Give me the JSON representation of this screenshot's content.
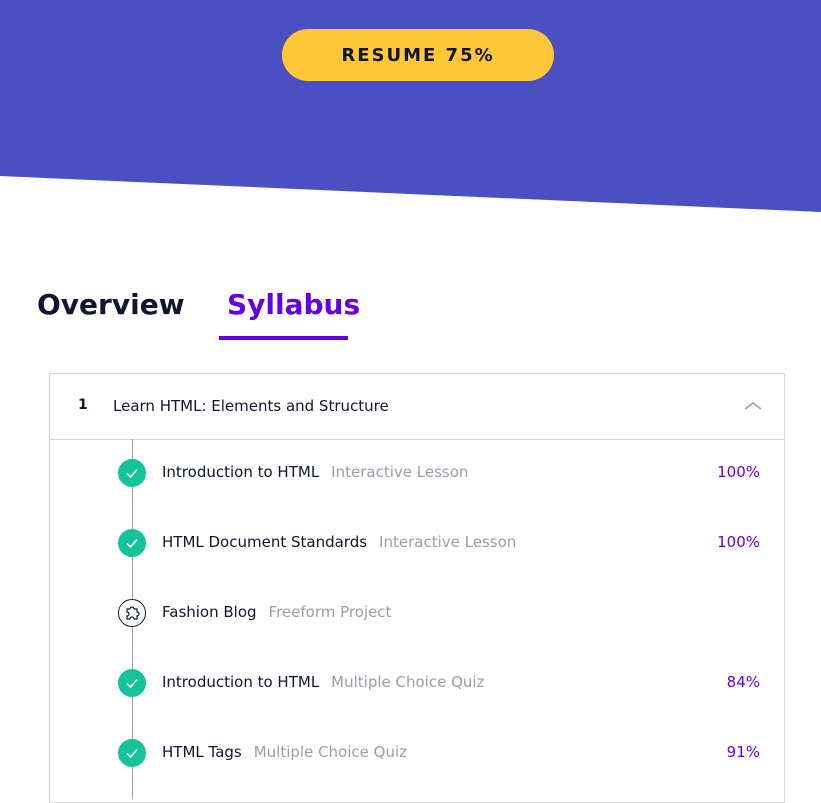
{
  "hero": {
    "resume_label": "RESUME 75%"
  },
  "tabs": [
    {
      "label": "Overview",
      "active": false
    },
    {
      "label": "Syllabus",
      "active": true
    }
  ],
  "module": {
    "number": "1",
    "title": "Learn HTML: Elements and Structure",
    "expanded": true,
    "items": [
      {
        "name": "Introduction to HTML",
        "type": "Interactive Lesson",
        "percent": "100%",
        "status": "completed"
      },
      {
        "name": "HTML Document Standards",
        "type": "Interactive Lesson",
        "percent": "100%",
        "status": "completed"
      },
      {
        "name": "Fashion Blog",
        "type": "Freeform Project",
        "percent": "",
        "status": "project"
      },
      {
        "name": "Introduction to HTML",
        "type": "Multiple Choice Quiz",
        "percent": "84%",
        "status": "completed"
      },
      {
        "name": "HTML Tags",
        "type": "Multiple Choice Quiz",
        "percent": "91%",
        "status": "completed"
      }
    ]
  },
  "colors": {
    "hero_bg": "#4a50c2",
    "resume_bg": "#ffc737",
    "accent": "#6400e4",
    "complete": "#15c39a",
    "muted": "#9a9da8",
    "text": "#10162f"
  }
}
